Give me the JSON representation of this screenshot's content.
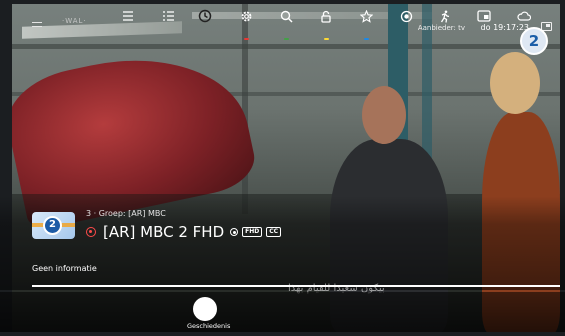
{
  "top_bar": {
    "provider_logo": "·WAL·",
    "provider_text": "Aanbieder: tv",
    "datetime": "do 19:17:23"
  },
  "corner_badge": "2",
  "channel": {
    "logo_text": "2",
    "group_line": "3 · Groep: [AR] MBC",
    "title": "[AR] MBC 2 FHD",
    "badges": [
      "FHD",
      "CC"
    ],
    "no_info": "Geen informatie",
    "progress": 1.0
  },
  "subtitle": "بيكون سعيدا للقيام بهذا",
  "toolbar": {
    "active_label": "Geschiedenis",
    "buttons": [
      {
        "icon": "list-icon"
      },
      {
        "icon": "list-detail-icon"
      },
      {
        "icon": "history-icon",
        "label": "Geschiedenis",
        "active": true
      },
      {
        "icon": "gear-icon",
        "indicator": "#e53935"
      },
      {
        "icon": "search-icon",
        "indicator": "#43a047"
      },
      {
        "icon": "lock-icon",
        "indicator": "#fdd835"
      },
      {
        "icon": "star-icon",
        "indicator": "#1e88e5"
      },
      {
        "icon": "record-icon"
      },
      {
        "icon": "run-icon"
      },
      {
        "icon": "pip-icon"
      },
      {
        "icon": "cloud-icon"
      }
    ]
  }
}
